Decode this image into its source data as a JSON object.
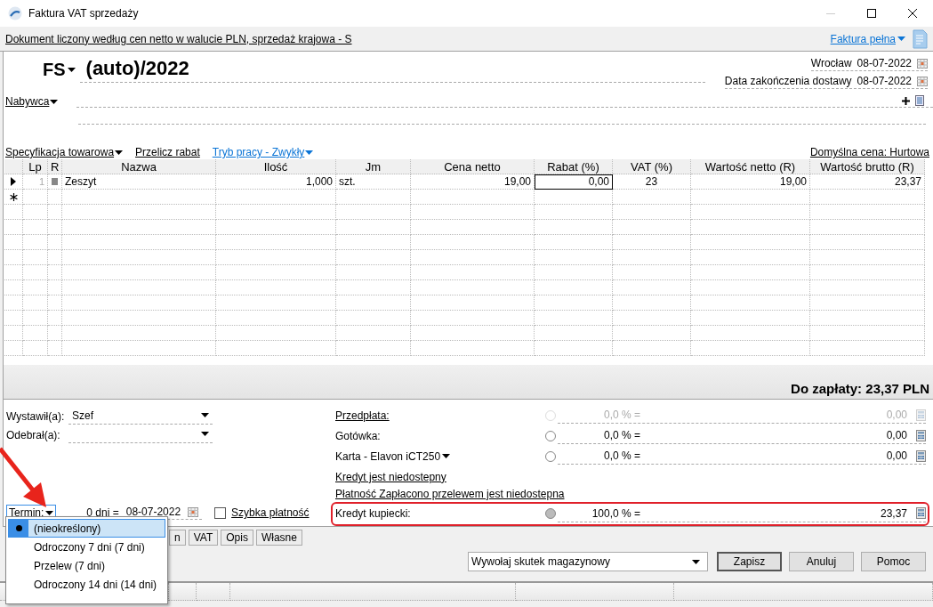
{
  "window": {
    "title": "Faktura VAT sprzedaży"
  },
  "info_bar": {
    "description": "Dokument liczony według cen netto w walucie PLN, sprzedaż krajowa - S",
    "invoice_type": "Faktura pełna"
  },
  "header": {
    "series": "FS",
    "number": "(auto)/2022",
    "place": "Wrocław",
    "issue_date": "08-07-2022",
    "delivery_label": "Data zakończenia dostawy",
    "delivery_date": "08-07-2022",
    "buyer_label": "Nabywca"
  },
  "toolbar": {
    "specification": "Specyfikacja towarowa",
    "recalc": "Przelicz rabat",
    "mode": "Tryb pracy - Zwykły",
    "default_price": "Domyślna cena: Hurtowa"
  },
  "table": {
    "columns": [
      {
        "label": "Lp",
        "kind": "ordinal"
      },
      {
        "label": "R",
        "kind": "icon"
      },
      {
        "label": "Nazwa",
        "kind": "text"
      },
      {
        "label": "Ilość",
        "kind": "number"
      },
      {
        "label": "Jm",
        "kind": "text"
      },
      {
        "label": "Cena netto",
        "kind": "number"
      },
      {
        "label": "Rabat (%)",
        "kind": "number"
      },
      {
        "label": "VAT (%)",
        "kind": "center"
      },
      {
        "label": "Wartość netto (R)",
        "kind": "number"
      },
      {
        "label": "Wartość brutto (R)",
        "kind": "number"
      }
    ],
    "rows": [
      {
        "kind": "current",
        "cells": [
          {
            "text": "1",
            "focused": false
          },
          {
            "text": "Zeszyt",
            "focused": false
          },
          {
            "text": "1,000",
            "focused": false
          },
          {
            "text": "szt.",
            "focused": false
          },
          {
            "text": "19,00",
            "focused": false
          },
          {
            "text": "0,00",
            "focused": true
          },
          {
            "text": "23",
            "focused": false
          },
          {
            "text": "19,00",
            "focused": false
          },
          {
            "text": "23,37",
            "focused": false
          }
        ]
      },
      {
        "kind": "new"
      }
    ]
  },
  "total": "Do zapłaty: 23,37 PLN",
  "issued_by": {
    "label": "Wystawił(a):",
    "value": "Szef"
  },
  "received_by": {
    "label": "Odebrał(a):"
  },
  "payments": [
    {
      "kind": "payment",
      "label": "Przedpłata:",
      "link": true,
      "disabled": true,
      "selected": false,
      "highlighted": false,
      "percent": "0,0 % =",
      "amount": "0,00"
    },
    {
      "kind": "payment",
      "label": "Gotówka:",
      "link": false,
      "disabled": false,
      "selected": false,
      "highlighted": false,
      "percent": "0,0 % =",
      "amount": "0,00"
    },
    {
      "kind": "card",
      "label": "Karta - Elavon iCT250",
      "link": false,
      "disabled": false,
      "selected": false,
      "highlighted": false,
      "percent": "0,0 % =",
      "amount": "0,00"
    },
    {
      "kind": "note",
      "label": "Kredyt jest niedostepny"
    },
    {
      "kind": "note",
      "label": "Płatność Zapłacono przelewem jest niedostepna"
    },
    {
      "kind": "payment",
      "label": "Kredyt kupiecki:",
      "link": false,
      "disabled": false,
      "selected": true,
      "highlighted": true,
      "percent": "100,0 % =",
      "amount": "23,37"
    }
  ],
  "term": {
    "label": "Termin:",
    "days": "0 dni =",
    "date": "08-07-2022",
    "quick_payment": {
      "label": "Szybka płatność",
      "checked": false
    }
  },
  "term_menu": [
    {
      "label": "(nieokreślony)",
      "selected": true
    },
    {
      "label": "Odroczony 7 dni (7 dni)",
      "selected": false
    },
    {
      "label": "Przelew (7 dni)",
      "selected": false
    },
    {
      "label": "Odroczony 14 dni (14 dni)",
      "selected": false
    }
  ],
  "tabs": [
    {
      "label": "n"
    },
    {
      "label": "VAT"
    },
    {
      "label": "Opis"
    },
    {
      "label": "Własne"
    }
  ],
  "warehouse_action": "Wywołaj skutek magazynowy",
  "buttons": [
    {
      "label": "Zapisz",
      "default": true
    },
    {
      "label": "Anuluj",
      "default": false
    },
    {
      "label": "Pomoc",
      "default": false
    }
  ]
}
